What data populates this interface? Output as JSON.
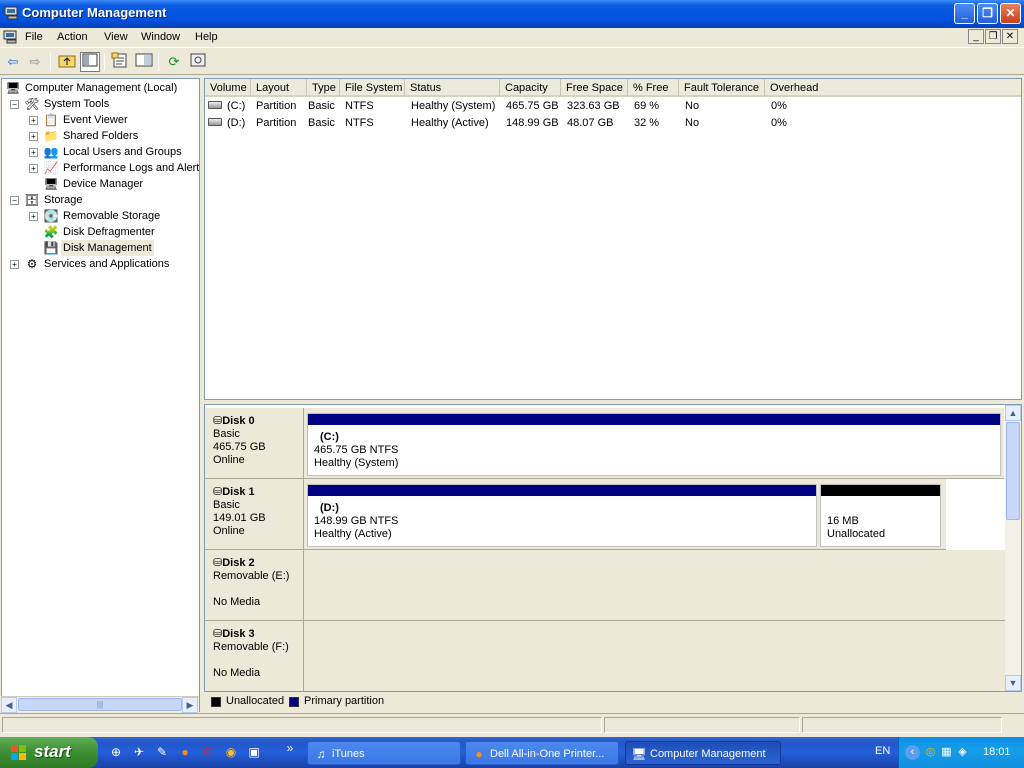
{
  "window": {
    "title": "Computer Management",
    "min": "_",
    "max": "❐",
    "close": "✕"
  },
  "menu": {
    "items": [
      "File",
      "Action",
      "View",
      "Window",
      "Help"
    ],
    "child_min": "_",
    "child_max": "❐",
    "child_close": "✕"
  },
  "toolbar": {
    "buttons": [
      "back-icon",
      "forward-icon",
      "up-folder-icon",
      "show-hide-tree-icon",
      "properties-icon",
      "help-topic-icon",
      "refresh-icon",
      "settings-icon"
    ]
  },
  "tree": {
    "root": "Computer Management (Local)",
    "system_tools": "System Tools",
    "event_viewer": "Event Viewer",
    "shared_folders": "Shared Folders",
    "local_users": "Local Users and Groups",
    "perf_logs": "Performance Logs and Alerts",
    "device_manager": "Device Manager",
    "storage": "Storage",
    "removable_storage": "Removable Storage",
    "disk_defrag": "Disk Defragmenter",
    "disk_management": "Disk Management",
    "services": "Services and Applications",
    "scroll_thumb": "|||"
  },
  "volumes": {
    "columns": [
      "Volume",
      "Layout",
      "Type",
      "File System",
      "Status",
      "Capacity",
      "Free Space",
      "% Free",
      "Fault Tolerance",
      "Overhead"
    ],
    "rows": [
      [
        "(C:)",
        "Partition",
        "Basic",
        "NTFS",
        "Healthy (System)",
        "465.75 GB",
        "323.63 GB",
        "69 %",
        "No",
        "0%"
      ],
      [
        "(D:)",
        "Partition",
        "Basic",
        "NTFS",
        "Healthy (Active)",
        "148.99 GB",
        "48.07 GB",
        "32 %",
        "No",
        "0%"
      ]
    ]
  },
  "disks": [
    {
      "name": "Disk 0",
      "type": "Basic",
      "size": "465.75 GB",
      "state": "Online",
      "partitions": [
        {
          "label": "(C:)",
          "size": "465.75 GB NTFS",
          "status": "Healthy (System)"
        }
      ]
    },
    {
      "name": "Disk 1",
      "type": "Basic",
      "size": "149.01 GB",
      "state": "Online",
      "partitions": [
        {
          "label": "(D:)",
          "size": "148.99 GB NTFS",
          "status": "Healthy (Active)"
        }
      ],
      "unallocated": {
        "size": "16 MB",
        "status": "Unallocated"
      }
    },
    {
      "name": "Disk 2",
      "type": "Removable (E:)",
      "state": "No Media"
    },
    {
      "name": "Disk 3",
      "type": "Removable (F:)",
      "state": "No Media"
    }
  ],
  "legend": {
    "unallocated": "Unallocated",
    "primary": "Primary partition"
  },
  "colors": {
    "primary": "#000080",
    "unallocated": "#000000",
    "title_bar": "#0053e1"
  },
  "taskbar": {
    "start": "start",
    "more": "»",
    "tasks": [
      "iTunes",
      "Dell All-in-One Printer...",
      "Computer Management"
    ],
    "lang": "EN",
    "clock": "18:01"
  }
}
